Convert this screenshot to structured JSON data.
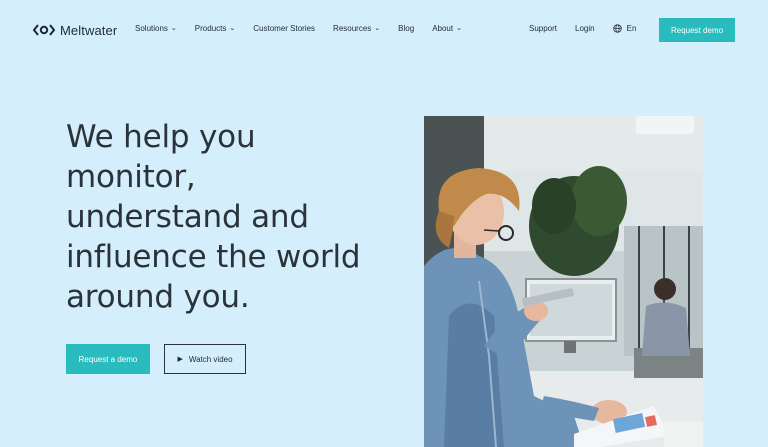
{
  "brand": {
    "name": "Meltwater"
  },
  "nav": {
    "items": [
      {
        "label": "Solutions",
        "has_dropdown": true
      },
      {
        "label": "Products",
        "has_dropdown": true
      },
      {
        "label": "Customer Stories",
        "has_dropdown": false
      },
      {
        "label": "Resources",
        "has_dropdown": true
      },
      {
        "label": "Blog",
        "has_dropdown": false
      },
      {
        "label": "About",
        "has_dropdown": true
      }
    ],
    "support": "Support",
    "login": "Login",
    "language": "En",
    "request_demo": "Request demo"
  },
  "hero": {
    "title_lines": [
      "We help you",
      "monitor,",
      "understand and",
      "influence the world",
      "around you."
    ],
    "primary_cta": "Request a demo",
    "secondary_cta": "Watch video"
  },
  "colors": {
    "background": "#d4effb",
    "accent": "#2abbbf",
    "text": "#1e2a33"
  },
  "icons": {
    "chevron": "chevron-down-icon",
    "globe": "globe-icon",
    "play": "play-icon"
  }
}
